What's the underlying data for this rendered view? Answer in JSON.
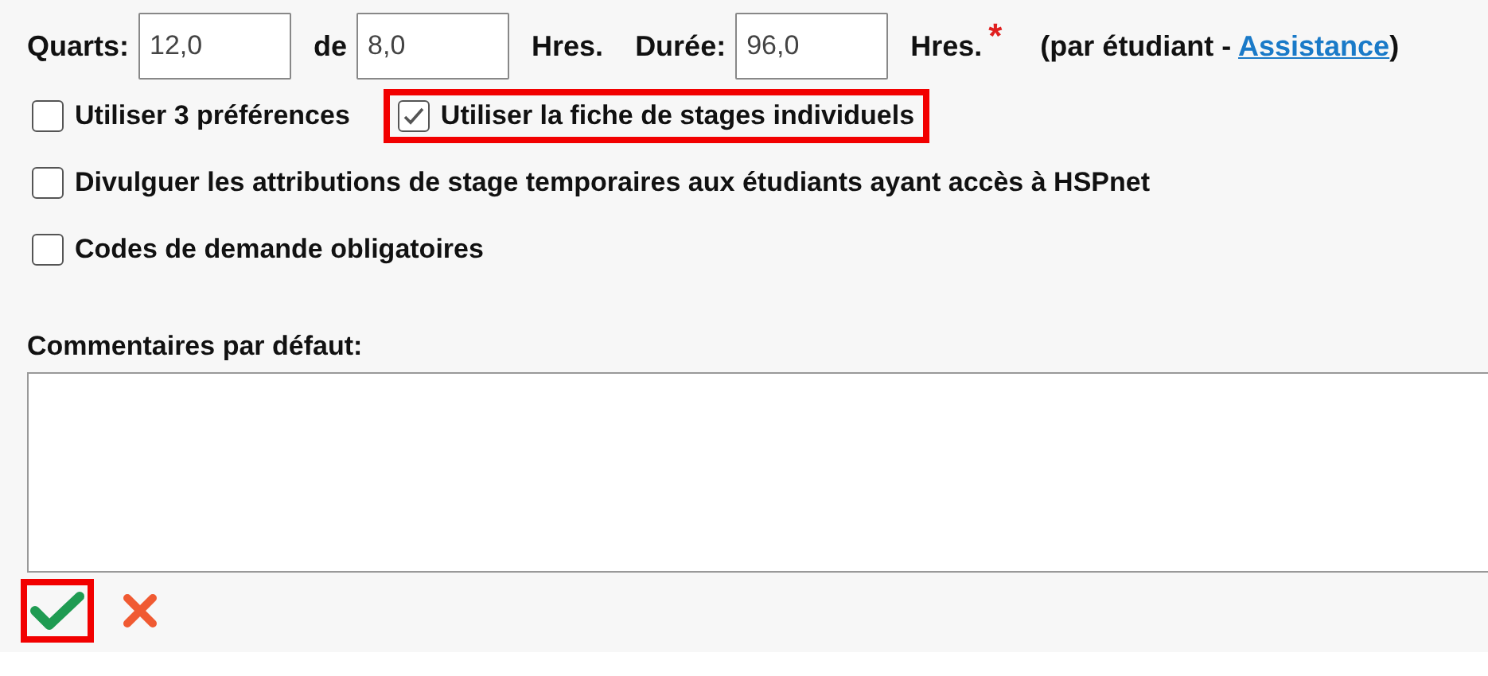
{
  "schedule": {
    "shifts_label": "Quarts:",
    "shifts_value": "12,0",
    "of_label": "de",
    "hours_value": "8,0",
    "hours_unit": "Hres.",
    "duration_label": "Durée:",
    "duration_value": "96,0",
    "duration_unit": "Hres.",
    "required_mark": "*",
    "note_prefix": "(par étudiant - ",
    "help_link": "Assistance",
    "note_suffix": ")"
  },
  "option_rows": [
    [
      {
        "label": "Utiliser 3 préférences",
        "checked": false,
        "highlighted": false
      },
      {
        "label": "Utiliser la fiche de stages individuels",
        "checked": true,
        "highlighted": true
      }
    ],
    [
      {
        "label": "Divulguer les attributions de stage temporaires aux étudiants ayant accès à HSPnet",
        "checked": false,
        "highlighted": false
      }
    ],
    [
      {
        "label": "Codes de demande obligatoires",
        "checked": false,
        "highlighted": false
      }
    ]
  ],
  "comments": {
    "label": "Commentaires par défaut:"
  },
  "actions": [
    {
      "kind": "confirm",
      "highlighted": true
    },
    {
      "kind": "cancel",
      "highlighted": false
    }
  ]
}
